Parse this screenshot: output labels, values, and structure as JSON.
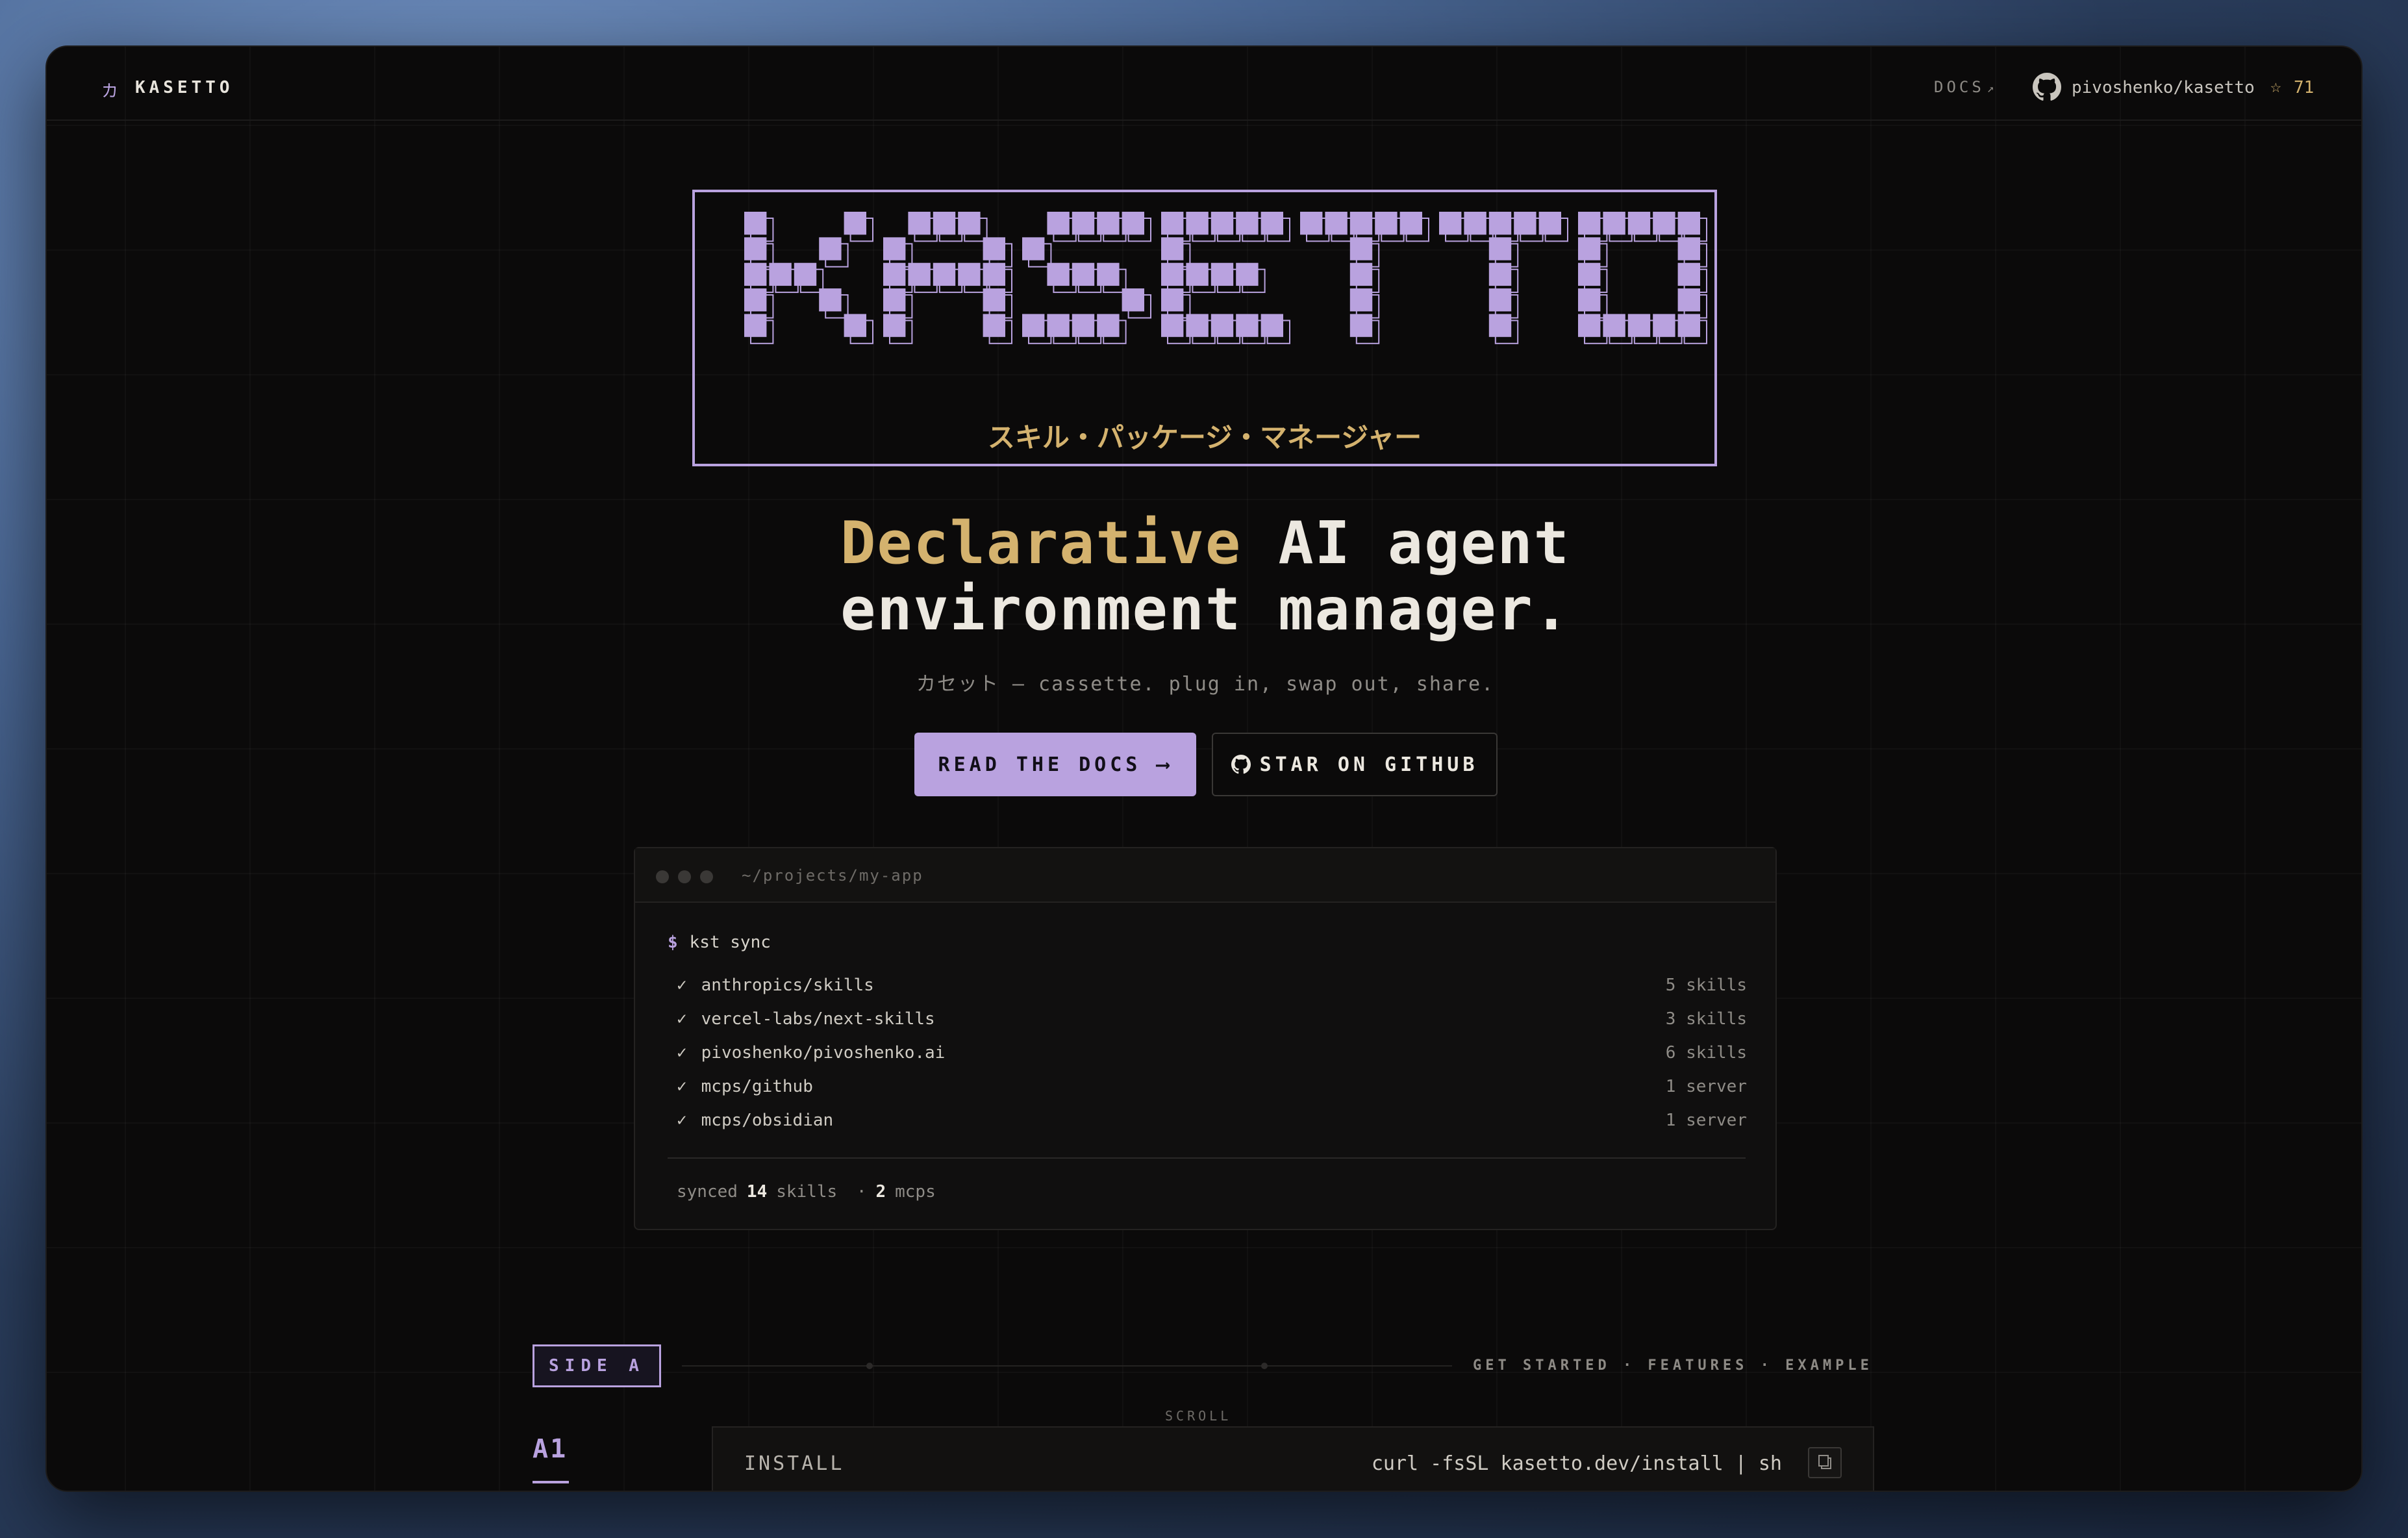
{
  "nav": {
    "brand_glyph": "カ",
    "brand_name": "KASETTO",
    "docs_label": "DOCS",
    "docs_arrow": "↗",
    "repo": "pivoshenko/kasetto",
    "star_glyph": "☆",
    "stars": "71"
  },
  "hero": {
    "logo_text": "KASETTO",
    "logo_subtitle": "スキル・パッケージ・マネージャー",
    "headline_accent": "Declarative",
    "headline_rest_line1": " AI agent",
    "headline_line2": "environment manager.",
    "tagline": "カセット — cassette. plug in, swap out, share.",
    "primary_button": "READ THE DOCS ⟶",
    "secondary_button": "STAR ON GITHUB"
  },
  "terminal": {
    "path": "~/projects/my-app",
    "prompt_symbol": "$",
    "command": "kst sync",
    "check_glyph": "✓",
    "rows": [
      {
        "name": "anthropics/skills",
        "count": "5 skills"
      },
      {
        "name": "vercel-labs/next-skills",
        "count": "3 skills"
      },
      {
        "name": "pivoshenko/pivoshenko.ai",
        "count": "6 skills"
      },
      {
        "name": "mcps/github",
        "count": "1 server"
      },
      {
        "name": "mcps/obsidian",
        "count": "1 server"
      }
    ],
    "summary": {
      "prefix": "synced",
      "skills_n": "14",
      "skills_label": "skills",
      "sep": "·",
      "mcps_n": "2",
      "mcps_label": "mcps"
    }
  },
  "sidea": {
    "badge": "SIDE A",
    "nav": "GET STARTED · FEATURES · EXAMPLE",
    "scroll_label": "SCROLL",
    "section_id": "A1",
    "install_label": "INSTALL",
    "install_cmd": "curl -fsSL kasetto.dev/install | sh"
  },
  "colors": {
    "accent": "#b9a2df",
    "gold": "#d4b26e",
    "background": "#0b0a0a"
  }
}
